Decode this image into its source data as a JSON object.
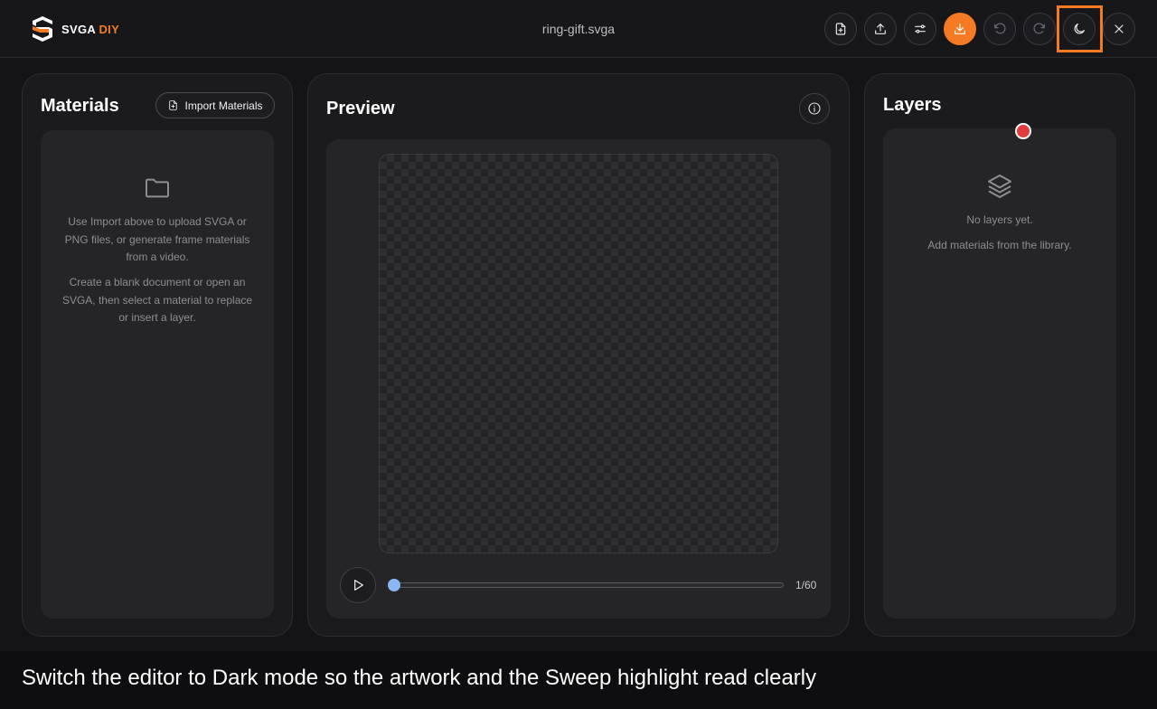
{
  "header": {
    "logo_text_a": "SVGA",
    "logo_text_b": "DIY",
    "document_title": "ring-gift.svga",
    "buttons": [
      {
        "name": "new-file-button",
        "icon": "file-plus-icon"
      },
      {
        "name": "upload-button",
        "icon": "upload-icon"
      },
      {
        "name": "settings-button",
        "icon": "sliders-icon"
      },
      {
        "name": "download-button",
        "icon": "download-icon"
      },
      {
        "name": "undo-button",
        "icon": "undo-icon"
      },
      {
        "name": "redo-button",
        "icon": "redo-icon"
      },
      {
        "name": "theme-toggle-button",
        "icon": "moon-icon"
      },
      {
        "name": "close-button",
        "icon": "close-icon"
      }
    ],
    "accent_color": "#f47a24"
  },
  "materials": {
    "title": "Materials",
    "import_label": "Import Materials",
    "empty_text_1": "Use Import above to upload SVGA or PNG files, or generate frame materials from a video.",
    "empty_text_2": "Create a blank document or open an SVGA, then select a material to replace or insert a layer."
  },
  "preview": {
    "title": "Preview",
    "frame_label": "1/60",
    "current_frame": 1,
    "total_frames": 60
  },
  "layers": {
    "title": "Layers",
    "empty_title": "No layers yet.",
    "empty_hint": "Add materials from the library."
  },
  "caption": "Switch the editor to Dark mode so the artwork and the Sweep highlight read clearly"
}
